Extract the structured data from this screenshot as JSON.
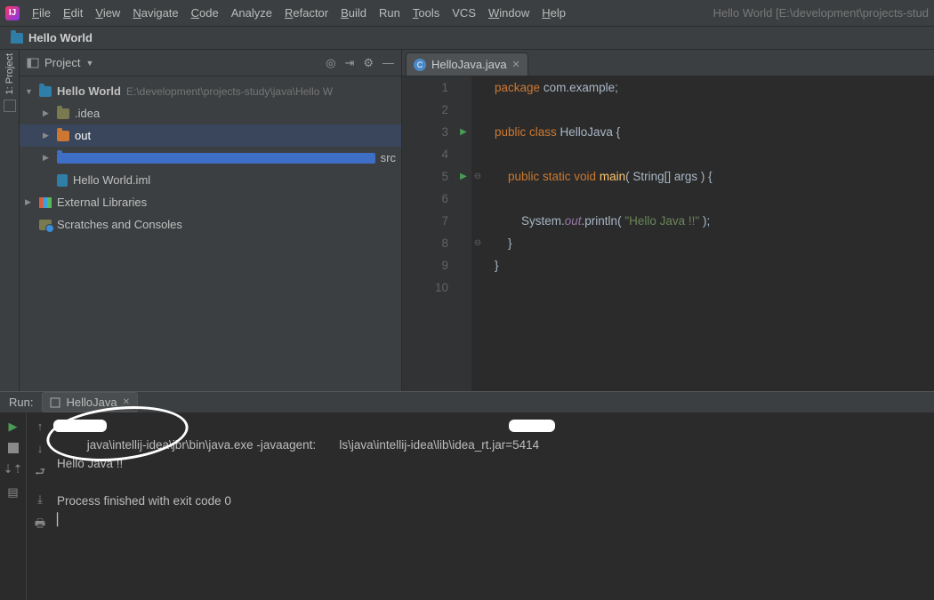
{
  "menu": {
    "items": [
      {
        "u": "F",
        "rest": "ile"
      },
      {
        "u": "E",
        "rest": "dit"
      },
      {
        "u": "V",
        "rest": "iew"
      },
      {
        "u": "N",
        "rest": "avigate"
      },
      {
        "u": "C",
        "rest": "ode"
      },
      {
        "u": "",
        "rest": "Analyze"
      },
      {
        "u": "R",
        "rest": "efactor"
      },
      {
        "u": "B",
        "rest": "uild"
      },
      {
        "u": "",
        "rest": "Run"
      },
      {
        "u": "T",
        "rest": "ools"
      },
      {
        "u": "",
        "rest": "VCS"
      },
      {
        "u": "W",
        "rest": "indow"
      },
      {
        "u": "H",
        "rest": "elp"
      }
    ]
  },
  "title_right": "Hello World [E:\\development\\projects-stud",
  "breadcrumb": "Hello World",
  "toolstrip": {
    "project_label": "1: Project"
  },
  "project": {
    "selector": "Project",
    "root": {
      "name": "Hello World",
      "path": "E:\\development\\projects-study\\java\\Hello W"
    },
    "children": [
      {
        "name": ".idea",
        "kind": "dir"
      },
      {
        "name": "out",
        "kind": "out",
        "selected": true
      },
      {
        "name": "src",
        "kind": "src"
      },
      {
        "name": "Hello World.iml",
        "kind": "iml",
        "leaf": true
      }
    ],
    "ext_lib": "External Libraries",
    "scratches": "Scratches and Consoles"
  },
  "editor": {
    "tab": "HelloJava.java",
    "lines": [
      {
        "n": 1,
        "html": "<span class='kw'>package</span> <span class='pk'>com.example</span>;"
      },
      {
        "n": 2,
        "html": ""
      },
      {
        "n": 3,
        "html": "<span class='kw'>public class</span> <span class='cls'>HelloJava</span> {",
        "run": true
      },
      {
        "n": 4,
        "html": ""
      },
      {
        "n": 5,
        "html": "    <span class='kw'>public static void</span> <span class='mth'>main</span>( String[] args ) {",
        "run": true,
        "fold": "⊖"
      },
      {
        "n": 6,
        "html": ""
      },
      {
        "n": 7,
        "html": "        System.<span class='fld'>out</span>.println( <span class='str'>\"Hello Java !!\"</span> );"
      },
      {
        "n": 8,
        "html": "    }",
        "fold": "⊖"
      },
      {
        "n": 9,
        "html": "}"
      },
      {
        "n": 10,
        "html": ""
      }
    ]
  },
  "run": {
    "label": "Run:",
    "tab": "HelloJava",
    "out1": "         java\\intellij-idea\\jbr\\bin\\java.exe -javaagent:       ls\\java\\intellij-idea\\lib\\idea_rt.jar=5414",
    "out2": "Hello Java !!",
    "out3": "",
    "out4": "Process finished with exit code 0",
    "out5": "▏"
  }
}
